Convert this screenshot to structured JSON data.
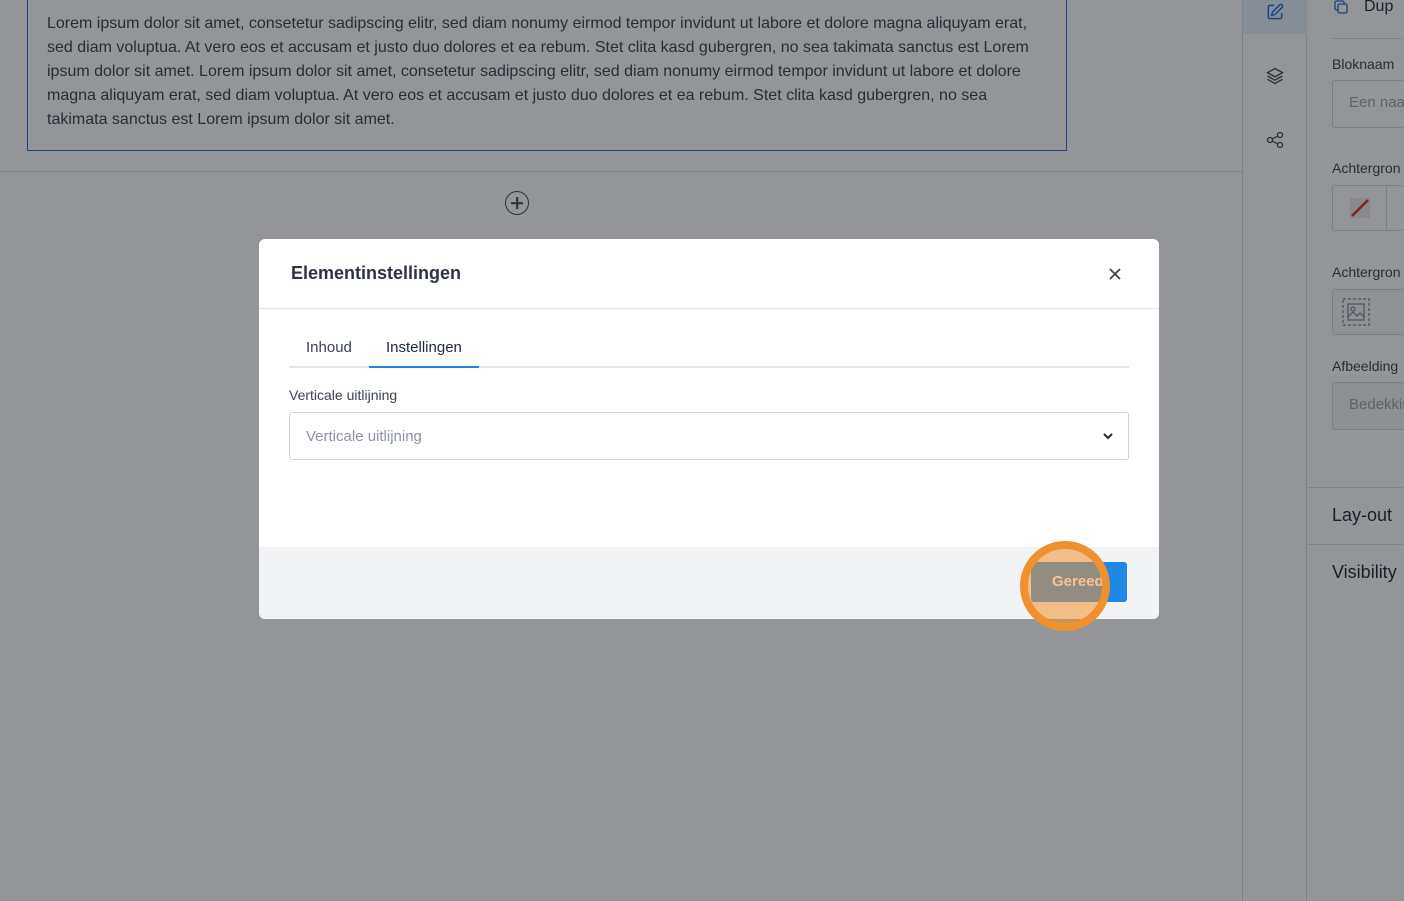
{
  "canvas": {
    "paragraph": "Lorem ipsum dolor sit amet, consetetur sadipscing elitr, sed diam nonumy eirmod tempor invidunt ut labore et dolore magna aliquyam erat, sed diam voluptua. At vero eos et accusam et justo duo dolores et ea rebum. Stet clita kasd gubergren, no sea takimata sanctus est Lorem ipsum dolor sit amet. Lorem ipsum dolor sit amet, consetetur sadipscing elitr, sed diam nonumy eirmod tempor invidunt ut labore et dolore magna aliquyam erat, sed diam voluptua. At vero eos et accusam et justo duo dolores et ea rebum. Stet clita kasd gubergren, no sea takimata sanctus est Lorem ipsum dolor sit amet."
  },
  "rail": {
    "items": [
      {
        "icon": "edit-icon",
        "active": true
      },
      {
        "icon": "layers-icon",
        "active": false
      },
      {
        "icon": "share-icon",
        "active": false
      }
    ]
  },
  "panel": {
    "duplicate_label": "Dup",
    "block_name_label": "Bloknaam",
    "block_name_placeholder": "Een naa",
    "bg_color_label": "Achtergron",
    "bg_image_label": "Achtergron",
    "image_label": "Afbeelding",
    "image_fit_value": "Bedekkin",
    "layout_section": "Lay-out",
    "visibility_section": "Visibility"
  },
  "modal": {
    "title": "Elementinstellingen",
    "tabs": [
      {
        "label": "Inhoud",
        "active": false
      },
      {
        "label": "Instellingen",
        "active": true
      }
    ],
    "field_label": "Verticale uitlijning",
    "select_placeholder": "Verticale uitlijning",
    "done_label": "Gereed"
  },
  "colors": {
    "accent": "#1f88e5",
    "click_marker": "#f0912f"
  }
}
